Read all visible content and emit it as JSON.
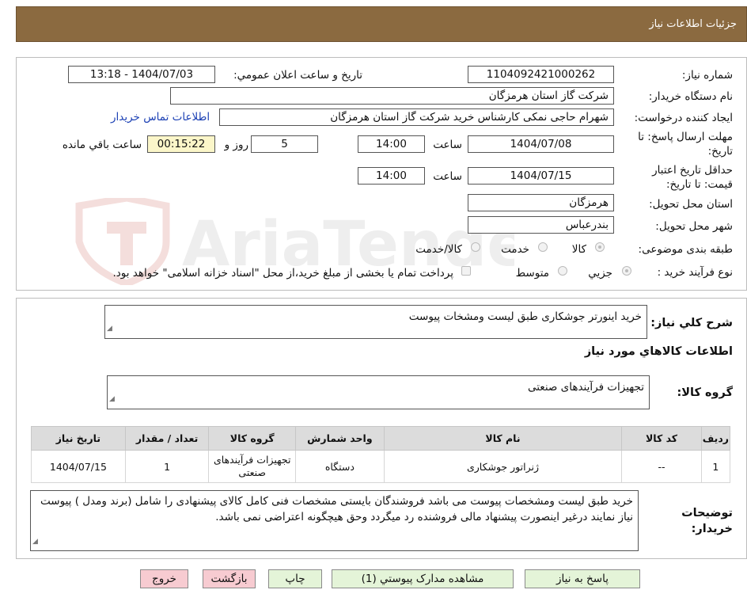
{
  "header": {
    "title": "جزئیات اطلاعات نیاز"
  },
  "watermark": {
    "text": "AriaTender.neT"
  },
  "form": {
    "need_number_label": "شماره نیاز:",
    "need_number": "1104092421000262",
    "announce_label": "تاریخ و ساعت اعلان عمومي:",
    "announce_value": "1404/07/03 - 13:18",
    "buyer_org_label": "نام دستگاه خريدار:",
    "buyer_org": "شرکت گاز استان هرمزگان",
    "creator_label": "ايجاد کننده درخواست:",
    "creator": "شهرام حاجی نمکی کارشناس خرید شرکت گاز استان هرمزگان",
    "contact_link": "اطلاعات تماس خريدار",
    "reply_deadline_label": "مهلت ارسال پاسخ: تا تاریخ:",
    "reply_date": "1404/07/08",
    "time_label": "ساعت",
    "reply_time": "14:00",
    "days_value": "5",
    "days_label": "روز و",
    "remaining_time": "00:15:22",
    "remaining_label": "ساعت باقي مانده",
    "validity_label": "حداقل تاريخ اعتبار قيمت: تا تاریخ:",
    "validity_date": "1404/07/15",
    "validity_time": "14:00",
    "province_label": "استان محل تحويل:",
    "province": "هرمزگان",
    "city_label": "شهر محل تحويل:",
    "city": "بندرعباس",
    "category_label": "طبقه بندی موضوعی:",
    "category_options": [
      "کالا",
      "خدمت",
      "کالا/خدمت"
    ],
    "process_label": "نوع فرآيند خريد :",
    "process_options": [
      "جزیي",
      "متوسط"
    ],
    "payment_note": "پرداخت تمام يا بخشی از مبلغ خريد،از محل \"اسناد خزانه اسلامی\" خواهد بود."
  },
  "summary": {
    "desc_label": "شرح کلي نياز:",
    "desc_value": "خرید اینورتر جوشکاری طبق لیست ومشخات پیوست",
    "items_title": "اطلاعات کالاهاي مورد نياز",
    "group_label": "گروه کالا:",
    "group_value": "تجهیزات فرآیندهای صنعتی"
  },
  "table": {
    "headers": [
      "رديف",
      "کد کالا",
      "نام کالا",
      "واحد شمارش",
      "گروه کالا",
      "تعداد / مقدار",
      "تاريخ نياز"
    ],
    "rows": [
      [
        "1",
        "--",
        "ژنراتور جوشکاری",
        "دستگاه",
        "تجهیزات فرآیندهای صنعتی",
        "1",
        "1404/07/15"
      ]
    ]
  },
  "notes": {
    "label": "توضيحات خريدار:",
    "text": "خرید طبق لیست ومشخصات پیوست می باشد فروشندگان بایستی مشخصات فنی کامل کالای پیشنهادی را شامل (برند ومدل ) پیوست نیاز نمایند درغیر اینصورت پیشنهاد مالی فروشنده رد میگردد وحق هیچگونه اعتراضی نمی باشد."
  },
  "buttons": {
    "reply": "پاسخ به نياز",
    "attachments": "مشاهده مدارک پيوستي (1)",
    "print": "چاپ",
    "back": "بازگشت",
    "exit": "خروج"
  }
}
